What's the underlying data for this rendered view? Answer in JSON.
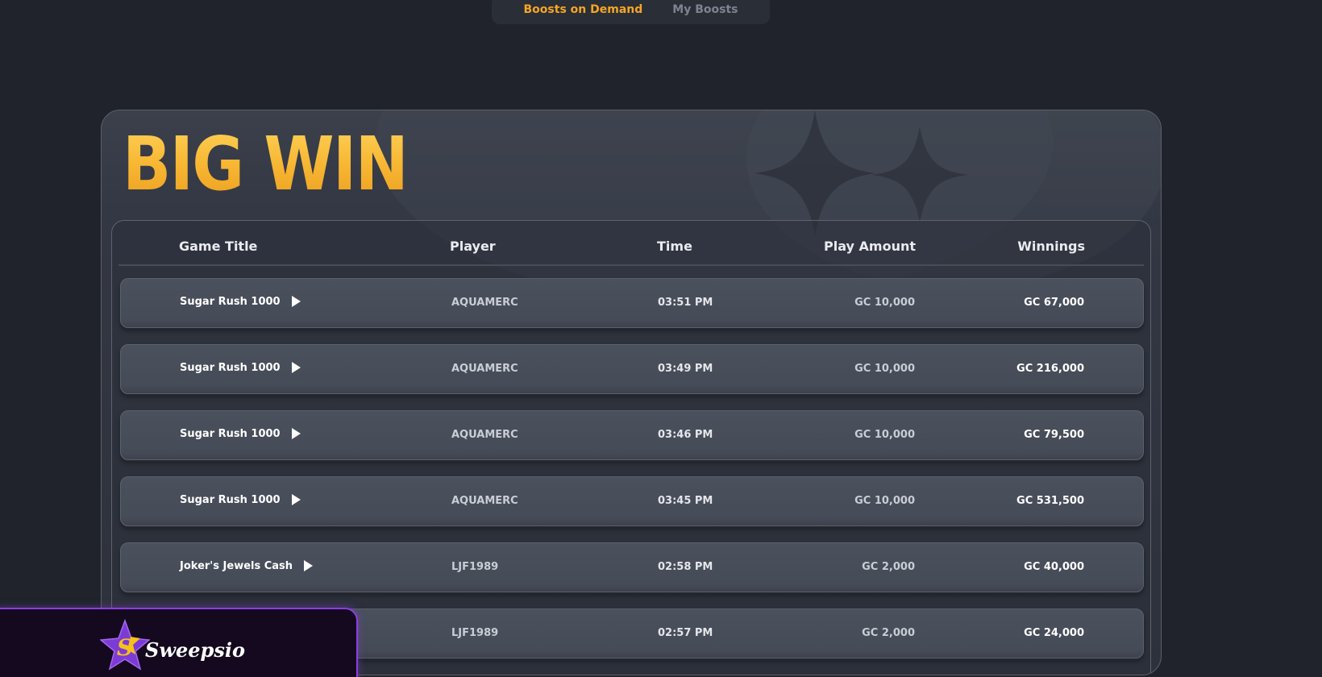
{
  "tabs": [
    {
      "label": "Boosts on Demand",
      "active": true
    },
    {
      "label": "My Boosts",
      "active": false
    }
  ],
  "big_win": {
    "title": "BIG WIN",
    "columns": {
      "game_title": "Game Title",
      "player": "Player",
      "time": "Time",
      "play_amount": "Play Amount",
      "winnings": "Winnings"
    },
    "rows": [
      {
        "game": "Sugar Rush 1000",
        "player": "AQUAMERC",
        "time": "03:51 PM",
        "play_amount": "GC 10,000",
        "winnings": "GC 67,000"
      },
      {
        "game": "Sugar Rush 1000",
        "player": "AQUAMERC",
        "time": "03:49 PM",
        "play_amount": "GC 10,000",
        "winnings": "GC 216,000"
      },
      {
        "game": "Sugar Rush 1000",
        "player": "AQUAMERC",
        "time": "03:46 PM",
        "play_amount": "GC 10,000",
        "winnings": "GC 79,500"
      },
      {
        "game": "Sugar Rush 1000",
        "player": "AQUAMERC",
        "time": "03:45 PM",
        "play_amount": "GC 10,000",
        "winnings": "GC 531,500"
      },
      {
        "game": "Joker's Jewels Cash",
        "player": "LJF1989",
        "time": "02:58 PM",
        "play_amount": "GC 2,000",
        "winnings": "GC 40,000"
      },
      {
        "game": "",
        "player": "LJF1989",
        "time": "02:57 PM",
        "play_amount": "GC 2,000",
        "winnings": "GC 24,000"
      }
    ]
  },
  "brand": {
    "name": "Sweepsio",
    "logo_icon": "star-s-logo-icon"
  },
  "colors": {
    "accent": "#f5a623",
    "background": "#20232b",
    "brand_purple": "#8b3ee0"
  }
}
